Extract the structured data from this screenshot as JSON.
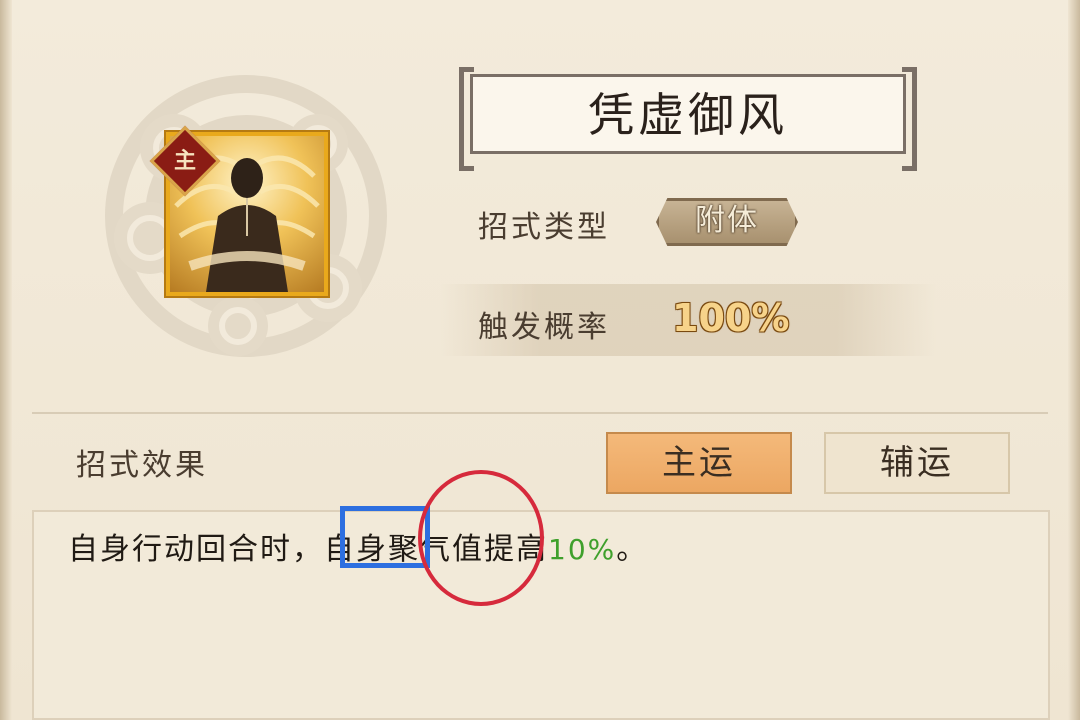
{
  "skill": {
    "name": "凭虚御风",
    "badge": "主",
    "type_label": "招式类型",
    "type_value": "附体",
    "prob_label": "触发概率",
    "prob_value": "100%"
  },
  "effect": {
    "section_label": "招式效果",
    "tabs": {
      "main": "主运",
      "assist": "辅运"
    },
    "text_prefix": "自身行动回合时，自身聚气值提高",
    "text_value": "10%",
    "text_suffix": "。"
  },
  "colors": {
    "highlight_value": "#3fa02c",
    "annotation_rect": "#2d6fe0",
    "annotation_circle": "#d62a3c",
    "tab_active": "#eca762"
  },
  "icons": {
    "emblem": "cloud-swirl-emblem",
    "skill": "wind-figure-icon"
  }
}
